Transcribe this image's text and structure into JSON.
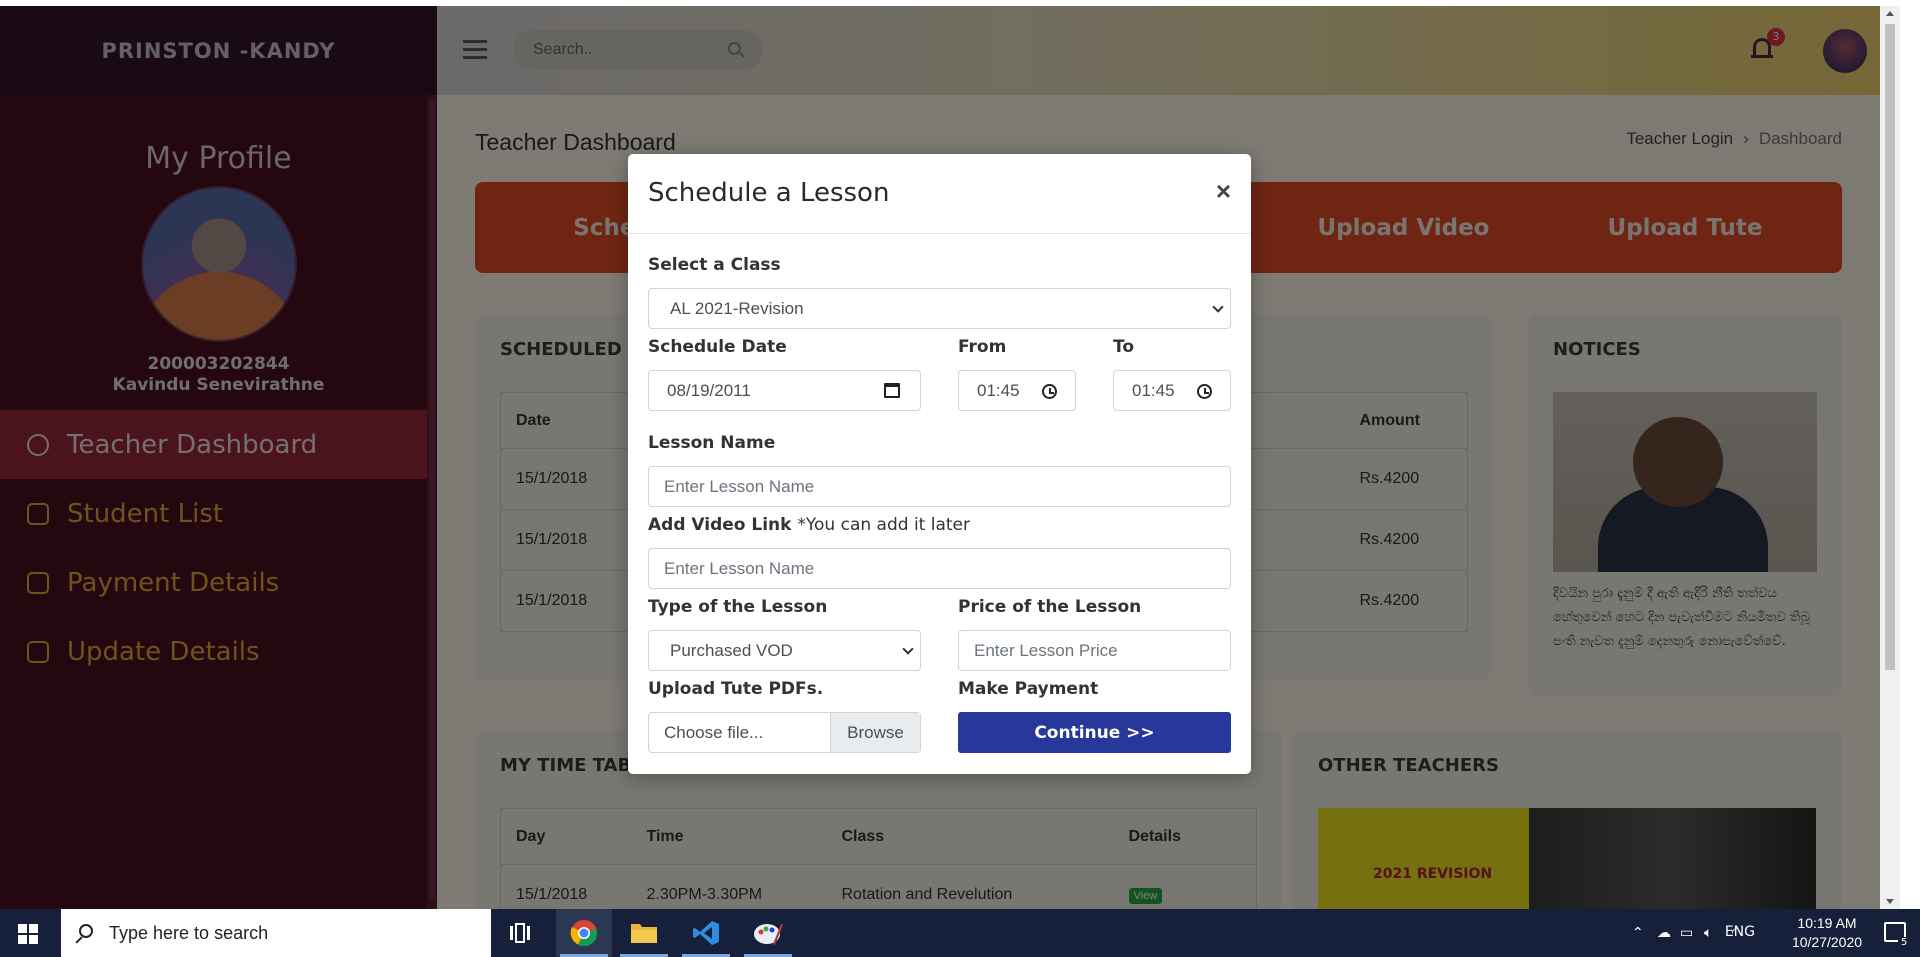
{
  "brand": "PRINSTON -KANDY",
  "profile": {
    "heading": "My Profile",
    "id": "200003202844",
    "name": "Kavindu Senevirathne"
  },
  "sidebar": {
    "items": [
      {
        "label": "Teacher Dashboard",
        "active": true
      },
      {
        "label": "Student List"
      },
      {
        "label": "Payment Details"
      },
      {
        "label": "Update Details"
      }
    ]
  },
  "topbar": {
    "search_placeholder": "Search..",
    "notification_count": "3"
  },
  "page": {
    "title": "Teacher Dashboard",
    "breadcrumb": [
      "Teacher Login",
      "Dashboard"
    ]
  },
  "actions": [
    "Schedule",
    "Upload Video",
    "Upload Tute"
  ],
  "scheduled": {
    "title": "SCHEDULED LE",
    "headers": [
      "Date",
      "Amount"
    ],
    "rows": [
      [
        "15/1/2018",
        "Rs.4200"
      ],
      [
        "15/1/2018",
        "Rs.4200"
      ],
      [
        "15/1/2018",
        "Rs.4200"
      ]
    ]
  },
  "notices": {
    "title": "NOTICES",
    "text": "දිවයින පුරා දැනුම් දී ඇති ඇදිරි නීති තත්වය හේතුවෙන් හෙට දින පැවැත්වීමට නියමිතව තිබූ පංති නැවත දැනුම් දෙනතුරු නොපැවේත්වේ."
  },
  "timetable": {
    "title": "MY TIME TABLE",
    "headers": [
      "Day",
      "Time",
      "Class",
      "Details"
    ],
    "rows": [
      {
        "day": "15/1/2018",
        "time": "2.30PM-3.30PM",
        "class": "Rotation and Revelution",
        "details": "View"
      }
    ]
  },
  "other_teachers": {
    "title": "OTHER TEACHERS",
    "banner_text": "2021 REVISION"
  },
  "modal": {
    "title": "Schedule a Lesson",
    "close": "×",
    "select_class_label": "Select a Class",
    "select_class_value": "AL 2021-Revision",
    "schedule_date_label": "Schedule Date",
    "schedule_date_value": "08/19/2011",
    "from_label": "From",
    "from_value": "01:45",
    "to_label": "To",
    "to_value": "01:45",
    "lesson_name_label": "Lesson Name",
    "lesson_name_placeholder": "Enter Lesson Name",
    "video_link_label": "Add Video Link",
    "video_link_note": "*You can add it later",
    "video_link_placeholder": "Enter Lesson Name",
    "type_label": "Type of the Lesson",
    "type_value": "Purchased VOD",
    "price_label": "Price of the Lesson",
    "price_placeholder": "Enter Lesson Price",
    "upload_label": "Upload Tute PDFs.",
    "upload_placeholder": "Choose file...",
    "browse_label": "Browse",
    "payment_label": "Make Payment",
    "continue_label": "Continue >>"
  },
  "taskbar": {
    "search_text": "Type here to search",
    "language": "ENG",
    "time": "10:19 AM",
    "date": "10/27/2020",
    "notification_count": "5"
  },
  "colors": {
    "sidebar_bg": "#4a0f1e",
    "action_orange": "#e14a24",
    "continue_blue": "#27389a"
  }
}
